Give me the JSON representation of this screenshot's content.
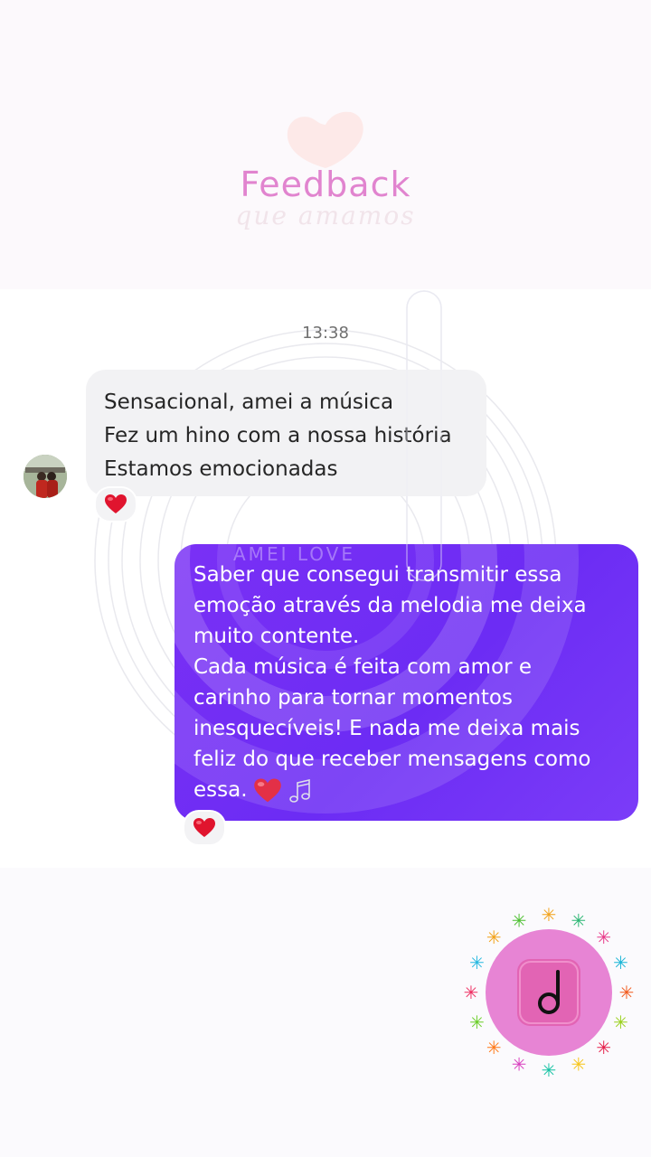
{
  "header": {
    "title": "Feedback",
    "subtitle": "que amamos"
  },
  "watermark": {
    "brand": "AMEI  LOVE"
  },
  "chat": {
    "timestamp": "13:38",
    "incoming": {
      "lines": [
        "Sensacional, amei a música",
        "Fez um hino com a nossa história",
        "Estamos emocionadas"
      ],
      "reaction": "heart"
    },
    "outgoing": {
      "lines": [
        "Saber que consegui transmitir essa",
        "emoção através da melodia me deixa",
        "muito contente.",
        "Cada música é feita com amor e",
        "carinho para tornar momentos",
        "inesquecíveis! E nada me deixa mais",
        "feliz do que receber mensagens como",
        "essa."
      ],
      "trailing_emojis": [
        "heart",
        "music-notes"
      ],
      "reaction": "heart"
    }
  },
  "colors": {
    "outgoing_bubble": "#6c2cf4",
    "incoming_bubble": "#f2f2f4",
    "title_pink": "#e184cf",
    "heart_red": "#e0142e"
  },
  "logo": {
    "icon": "music-note-icon"
  }
}
